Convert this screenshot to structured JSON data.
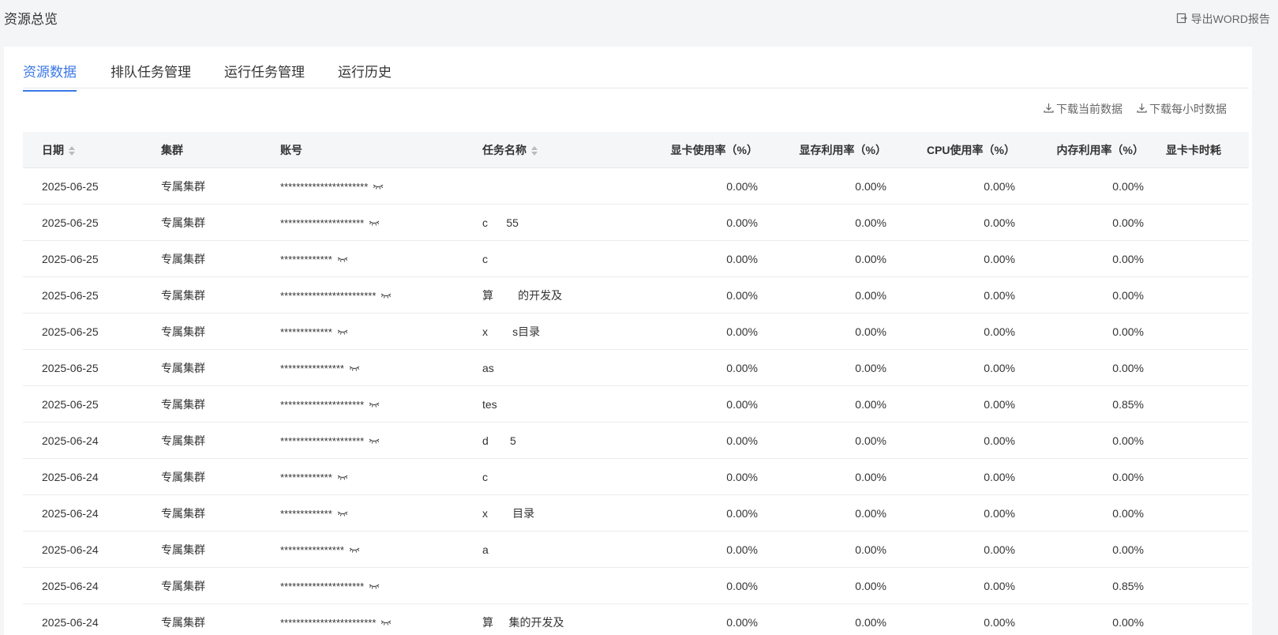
{
  "page": {
    "title": "资源总览",
    "export_label": "导出WORD报告"
  },
  "tabs": [
    "资源数据",
    "排队任务管理",
    "运行任务管理",
    "运行历史"
  ],
  "downloads": {
    "current": "下载当前数据",
    "hourly": "下载每小时数据"
  },
  "table": {
    "headers": {
      "date": "日期",
      "cluster": "集群",
      "account": "账号",
      "task": "任务名称",
      "gpu_usage": "显卡使用率（%）",
      "vram_usage": "显存利用率（%）",
      "cpu_usage": "CPU使用率（%）",
      "mem_usage": "内存利用率（%）",
      "gpu_time": "显卡卡时耗"
    },
    "rows": [
      {
        "date": "2025-06-25",
        "cluster": "专属集群",
        "account": "**********************",
        "task": "",
        "gpu": "0.00%",
        "vram": "0.00%",
        "cpu": "0.00%",
        "mem": "0.00%"
      },
      {
        "date": "2025-06-25",
        "cluster": "专属集群",
        "account": "*********************",
        "task": "c      55",
        "gpu": "0.00%",
        "vram": "0.00%",
        "cpu": "0.00%",
        "mem": "0.00%"
      },
      {
        "date": "2025-06-25",
        "cluster": "专属集群",
        "account": "*************",
        "task": "c",
        "gpu": "0.00%",
        "vram": "0.00%",
        "cpu": "0.00%",
        "mem": "0.00%"
      },
      {
        "date": "2025-06-25",
        "cluster": "专属集群",
        "account": "************************",
        "task": "算        的开发及",
        "gpu": "0.00%",
        "vram": "0.00%",
        "cpu": "0.00%",
        "mem": "0.00%"
      },
      {
        "date": "2025-06-25",
        "cluster": "专属集群",
        "account": "*************",
        "task": "x        s目录",
        "gpu": "0.00%",
        "vram": "0.00%",
        "cpu": "0.00%",
        "mem": "0.00%"
      },
      {
        "date": "2025-06-25",
        "cluster": "专属集群",
        "account": "****************",
        "task": "as",
        "gpu": "0.00%",
        "vram": "0.00%",
        "cpu": "0.00%",
        "mem": "0.00%"
      },
      {
        "date": "2025-06-25",
        "cluster": "专属集群",
        "account": "*********************",
        "task": "tes",
        "gpu": "0.00%",
        "vram": "0.00%",
        "cpu": "0.00%",
        "mem": "0.85%"
      },
      {
        "date": "2025-06-24",
        "cluster": "专属集群",
        "account": "*********************",
        "task": "d       5",
        "gpu": "0.00%",
        "vram": "0.00%",
        "cpu": "0.00%",
        "mem": "0.00%"
      },
      {
        "date": "2025-06-24",
        "cluster": "专属集群",
        "account": "*************",
        "task": "c",
        "gpu": "0.00%",
        "vram": "0.00%",
        "cpu": "0.00%",
        "mem": "0.00%"
      },
      {
        "date": "2025-06-24",
        "cluster": "专属集群",
        "account": "*************",
        "task": "x        目录",
        "gpu": "0.00%",
        "vram": "0.00%",
        "cpu": "0.00%",
        "mem": "0.00%"
      },
      {
        "date": "2025-06-24",
        "cluster": "专属集群",
        "account": "****************",
        "task": "a",
        "gpu": "0.00%",
        "vram": "0.00%",
        "cpu": "0.00%",
        "mem": "0.00%"
      },
      {
        "date": "2025-06-24",
        "cluster": "专属集群",
        "account": "*********************",
        "task": "",
        "gpu": "0.00%",
        "vram": "0.00%",
        "cpu": "0.00%",
        "mem": "0.85%"
      },
      {
        "date": "2025-06-24",
        "cluster": "专属集群",
        "account": "************************",
        "task": "算     集的开发及",
        "gpu": "0.00%",
        "vram": "0.00%",
        "cpu": "0.00%",
        "mem": "0.00%"
      }
    ]
  }
}
